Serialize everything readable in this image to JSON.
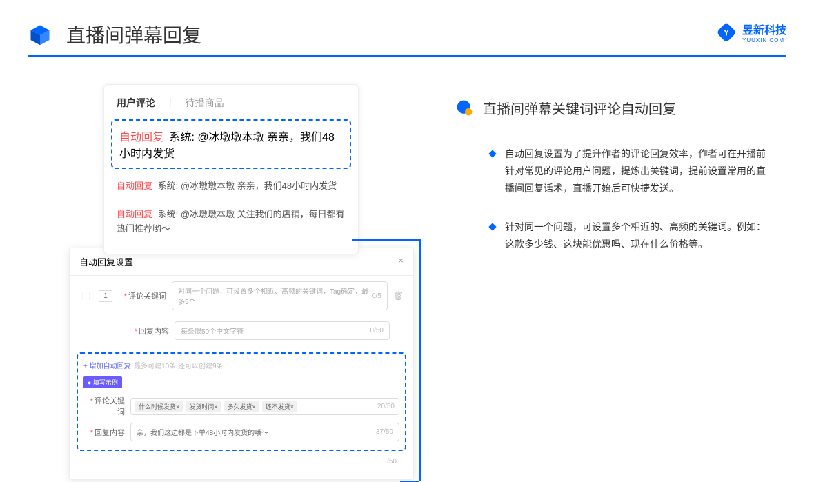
{
  "header": {
    "title": "直播间弹幕回复"
  },
  "logo": {
    "text": "昱新科技",
    "sub": "YUUXIN.COM"
  },
  "comments_card": {
    "tab_active": "用户评论",
    "tab_other": "待播商品",
    "items": [
      {
        "tag": "自动回复",
        "text": " 系统: @冰墩墩本墩 亲亲，我们48小时内发货"
      },
      {
        "tag": "自动回复",
        "text": " 系统: @冰墩墩本墩 亲亲，我们48小时内发货"
      },
      {
        "tag": "自动回复",
        "text": " 系统: @冰墩墩本墩 关注我们的店铺，每日都有热门推荐哟～"
      }
    ]
  },
  "settings": {
    "title": "自动回复设置",
    "index": "1",
    "label_keyword": "评论关键词",
    "placeholder_keyword": "对同一个问题，可设置多个相近、高频的关键词，Tag确定，最多5个",
    "counter_keyword": "0/5",
    "label_content": "回复内容",
    "placeholder_content": "每条限50个中文字符",
    "counter_content": "0/50",
    "add_link": "+ 增加自动回复",
    "add_hint": " 最多可建10条 还可以创建9条",
    "example_badge": "● 填写示例",
    "example_keyword_label": "评论关键词",
    "example_tags": [
      "什么时候发货×",
      "发货时间×",
      "多久发货×",
      "还不发货×"
    ],
    "example_kw_counter": "20/50",
    "example_content_label": "回复内容",
    "example_content": "亲，我们这边都是下单48小时内发货的哦～",
    "example_content_counter": "37/50",
    "outer_counter": "/50"
  },
  "right": {
    "title": "直播间弹幕关键词评论自动回复",
    "bullets": [
      "自动回复设置为了提升作者的评论回复效率，作者可在开播前针对常见的评论用户问题，提炼出关键词，提前设置常用的直播间回复话术，直播开始后可快捷发送。",
      "针对同一个问题，可设置多个相近的、高频的关键词。例如：这款多少钱、这块能优惠吗、现在什么价格等。"
    ]
  }
}
